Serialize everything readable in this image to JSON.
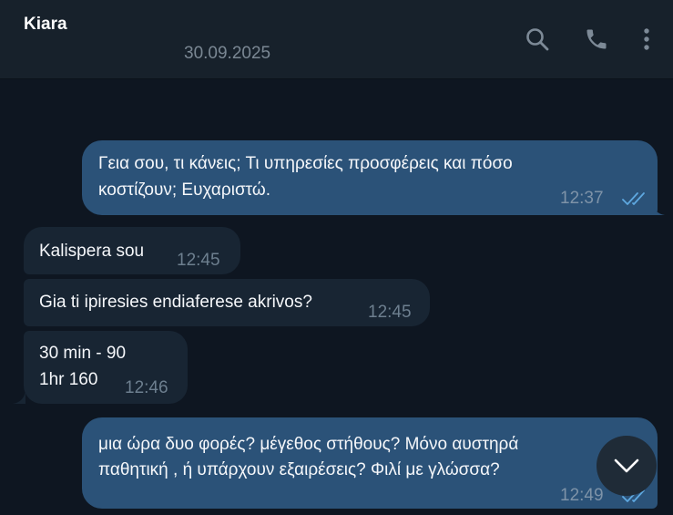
{
  "chat": {
    "contact_name": "Kiara",
    "date": "30.09.2025"
  },
  "header_icons": {
    "search": "search-icon",
    "call": "phone-icon",
    "menu": "more-vertical-icon"
  },
  "messages": [
    {
      "direction": "outgoing",
      "lines": [
        "Γεια σου, τι κάνεις; Τι υπηρεσίες προσφέρεις και πόσο",
        "κοστίζουν; Ευχαριστώ."
      ],
      "time": "12:37",
      "status": "read"
    },
    {
      "direction": "incoming",
      "lines": [
        "Kalispera sou"
      ],
      "time": "12:45"
    },
    {
      "direction": "incoming",
      "lines": [
        "Gia ti ipiresies endiaferese akrivos?"
      ],
      "time": "12:45"
    },
    {
      "direction": "incoming",
      "lines": [
        "30 min - 90",
        "1hr 160"
      ],
      "time": "12:46"
    },
    {
      "direction": "outgoing",
      "lines": [
        "μια ώρα δυο φορές? μέγεθος στήθους? Μόνο αυστηρά",
        "παθητική , ή υπάρχουν εξαιρέσεις? Φιλί με γλώσσα?"
      ],
      "time": "12:49",
      "status": "read"
    }
  ],
  "colors": {
    "background": "#0e1621",
    "header": "#17212b",
    "outgoing_bubble": "#2b5278",
    "incoming_bubble": "#182533",
    "read_ticks": "#5ea8e0"
  },
  "scroll_button_icon": "chevron-down-icon"
}
